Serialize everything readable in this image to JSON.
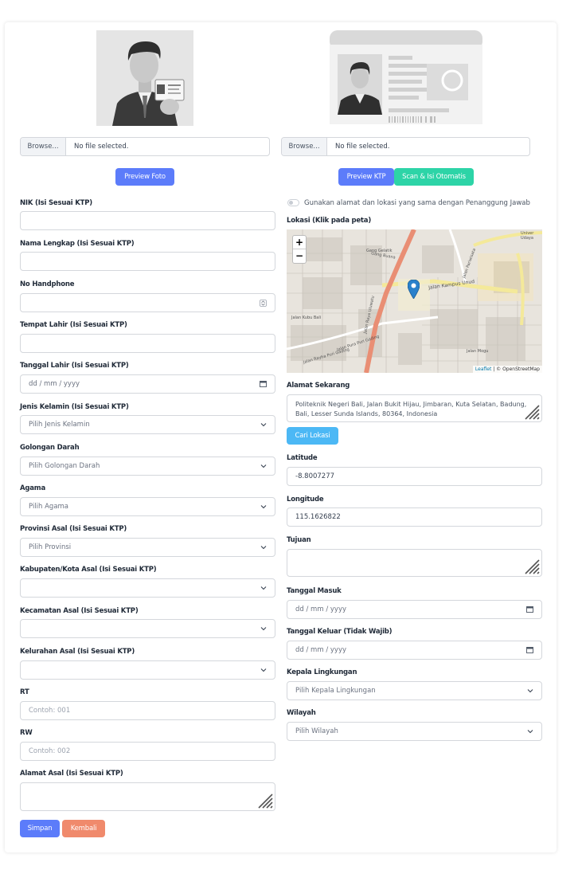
{
  "uploads": {
    "photo": {
      "browse_label": "Browse...",
      "file_name": "No file selected.",
      "preview_label": "Preview Foto"
    },
    "ktp": {
      "browse_label": "Browse...",
      "file_name": "No file selected.",
      "preview_label": "Preview KTP",
      "scan_label": "Scan & Isi Otomatis"
    }
  },
  "left_form": {
    "nik": {
      "label": "NIK (Isi Sesuai KTP)",
      "value": ""
    },
    "nama": {
      "label": "Nama Lengkap (Isi Sesuai KTP)",
      "value": ""
    },
    "hp": {
      "label": "No Handphone",
      "value": ""
    },
    "tempat_lahir": {
      "label": "Tempat Lahir (Isi Sesuai KTP)",
      "value": ""
    },
    "tanggal_lahir": {
      "label": "Tanggal Lahir (Isi Sesuai KTP)",
      "placeholder": "dd / mm / yyyy"
    },
    "jenis_kelamin": {
      "label": "Jenis Kelamin (Isi Sesuai KTP)",
      "selected": "Pilih Jenis Kelamin"
    },
    "golongan_darah": {
      "label": "Golongan Darah",
      "selected": "Pilih Golongan Darah"
    },
    "agama": {
      "label": "Agama",
      "selected": "Pilih Agama"
    },
    "provinsi": {
      "label": "Provinsi Asal (Isi Sesuai KTP)",
      "selected": "Pilih Provinsi"
    },
    "kabupaten": {
      "label": "Kabupaten/Kota Asal (Isi Sesuai KTP)",
      "selected": ""
    },
    "kecamatan": {
      "label": "Kecamatan Asal (Isi Sesuai KTP)",
      "selected": ""
    },
    "kelurahan": {
      "label": "Kelurahan Asal (Isi Sesuai KTP)",
      "selected": ""
    },
    "rt": {
      "label": "RT",
      "placeholder": "Contoh: 001"
    },
    "rw": {
      "label": "RW",
      "placeholder": "Contoh: 002"
    },
    "alamat_asal": {
      "label": "Alamat Asal (Isi Sesuai KTP)",
      "value": ""
    }
  },
  "right_form": {
    "same_address_toggle": "Gunakan alamat dan lokasi yang sama dengan Penanggung Jawab",
    "lokasi_label": "Lokasi (Klik pada peta)",
    "map": {
      "zoom_in": "+",
      "zoom_out": "−",
      "attribution_leaflet": "Leaflet",
      "attribution_rest": " | © OpenStreetMap",
      "street_labels": [
        "Jalan Kampus Unud",
        "Jalan Raya Uluwatu",
        "Jalan Pura Puri Gading",
        "Jalan Rayha Puri Gading",
        "Gang Buana",
        "Jalan Pariwisata",
        "Univer Udaya",
        "Jalan Mogu",
        "Gang Gelatik",
        "Jalan Kubu Bali"
      ]
    },
    "alamat_sekarang": {
      "label": "Alamat Sekarang",
      "value": "Politeknik Negeri Bali, Jalan Bukit Hijau, Jimbaran, Kuta Selatan, Badung, Bali, Lesser Sunda Islands, 80364, Indonesia"
    },
    "cari_lokasi_label": "Cari Lokasi",
    "latitude": {
      "label": "Latitude",
      "value": "-8.8007277"
    },
    "longitude": {
      "label": "Longitude",
      "value": "115.1626822"
    },
    "tujuan": {
      "label": "Tujuan",
      "value": ""
    },
    "tanggal_masuk": {
      "label": "Tanggal Masuk",
      "placeholder": "dd / mm / yyyy"
    },
    "tanggal_keluar": {
      "label": "Tanggal Keluar (Tidak Wajib)",
      "placeholder": "dd / mm / yyyy"
    },
    "kepala_lingkungan": {
      "label": "Kepala Lingkungan",
      "selected": "Pilih Kepala Lingkungan"
    },
    "wilayah": {
      "label": "Wilayah",
      "selected": "Pilih Wilayah"
    }
  },
  "actions": {
    "save_label": "Simpan",
    "back_label": "Kembali"
  },
  "colors": {
    "primary": "#5c7cfa",
    "teal": "#2dd4a7",
    "sky": "#4cb8f5",
    "coral": "#f08a6c"
  }
}
